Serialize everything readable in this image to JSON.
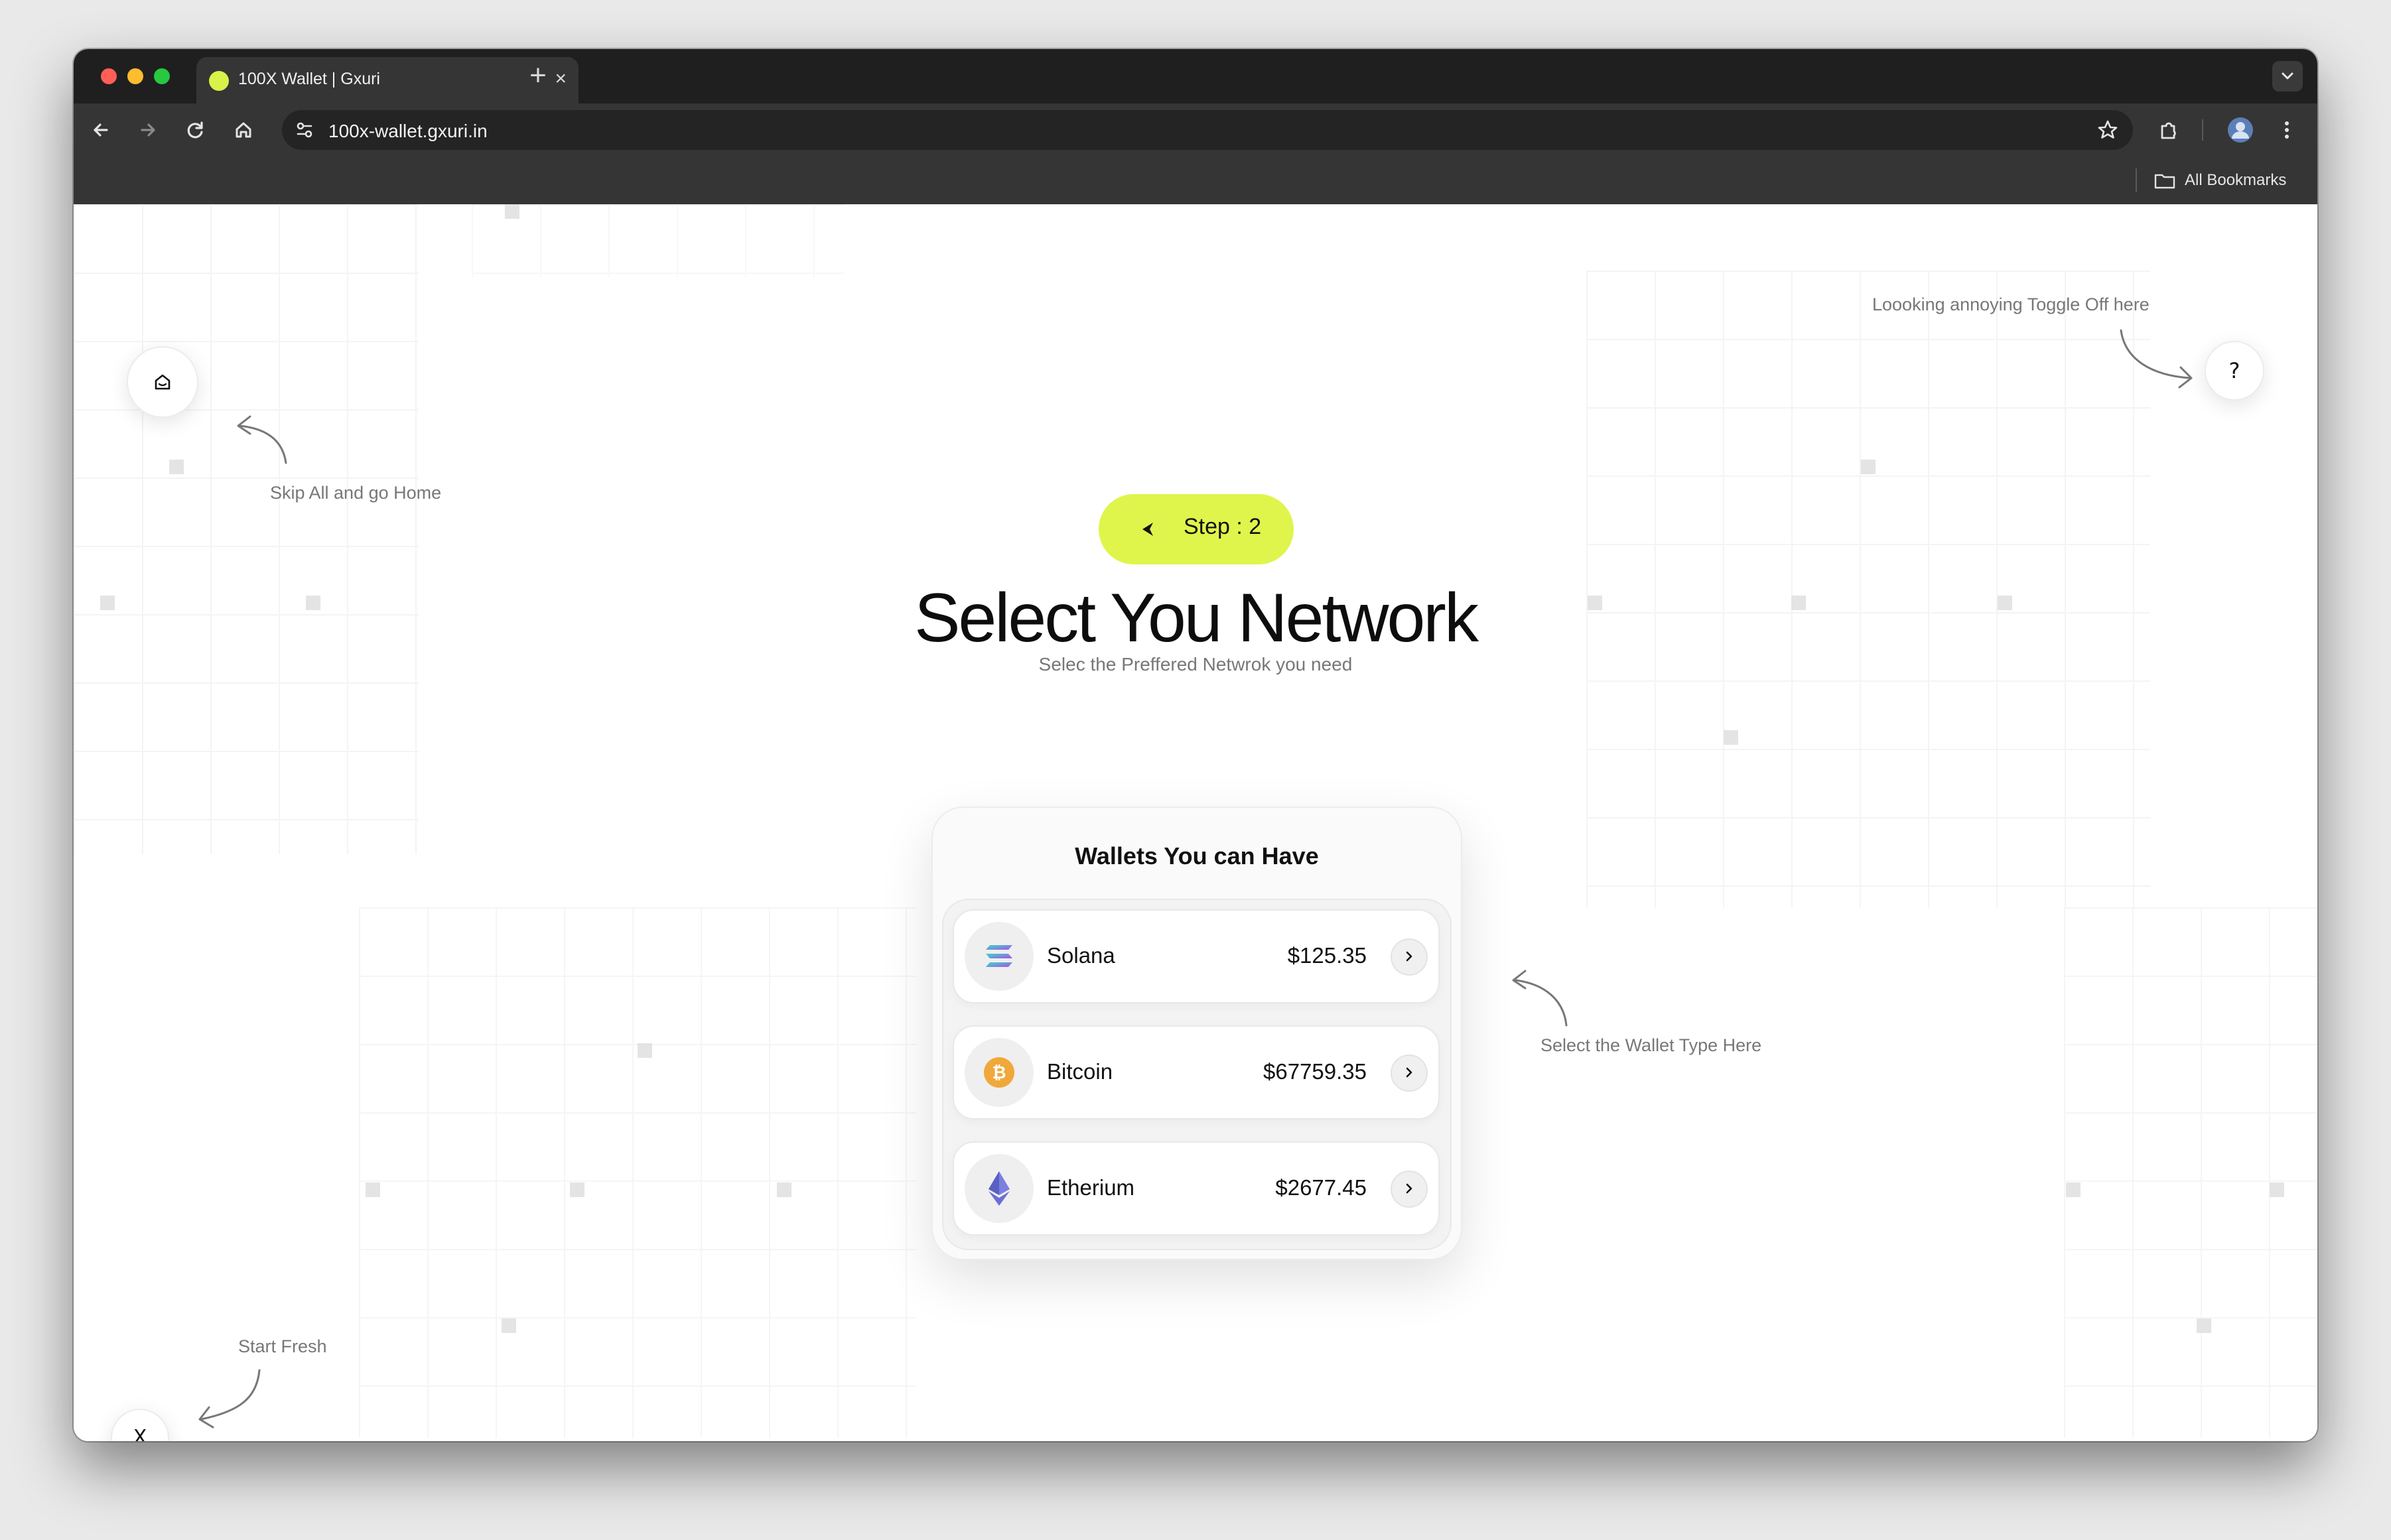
{
  "browser": {
    "tab_title": "100X Wallet | Gxuri",
    "tab_close": "×",
    "new_tab": "+",
    "url": "100x-wallet.gxuri.in",
    "bookmarks_label": "All Bookmarks"
  },
  "page": {
    "step_label": "Step : 2",
    "title": "Select You Network",
    "subtitle": "Selec the Preffered Netwrok you need",
    "hints": {
      "home": "Skip All and go Home",
      "help": "Loooking annoying Toggle Off here",
      "wallet": "Select the Wallet Type Here",
      "fresh": "Start Fresh"
    },
    "help_label": "?",
    "reset_label": "X",
    "card": {
      "title": "Wallets You can Have",
      "wallets": [
        {
          "name": "Solana",
          "value": "$125.35",
          "icon": "solana-icon"
        },
        {
          "name": "Bitcoin",
          "value": "$67759.35",
          "icon": "bitcoin-icon"
        },
        {
          "name": "Etherium",
          "value": "$2677.45",
          "icon": "ethereum-icon"
        }
      ]
    },
    "colors": {
      "accent": "#dff54b",
      "bitcoin": "#f0a83a",
      "ethereum": "#6a6fd8"
    }
  }
}
